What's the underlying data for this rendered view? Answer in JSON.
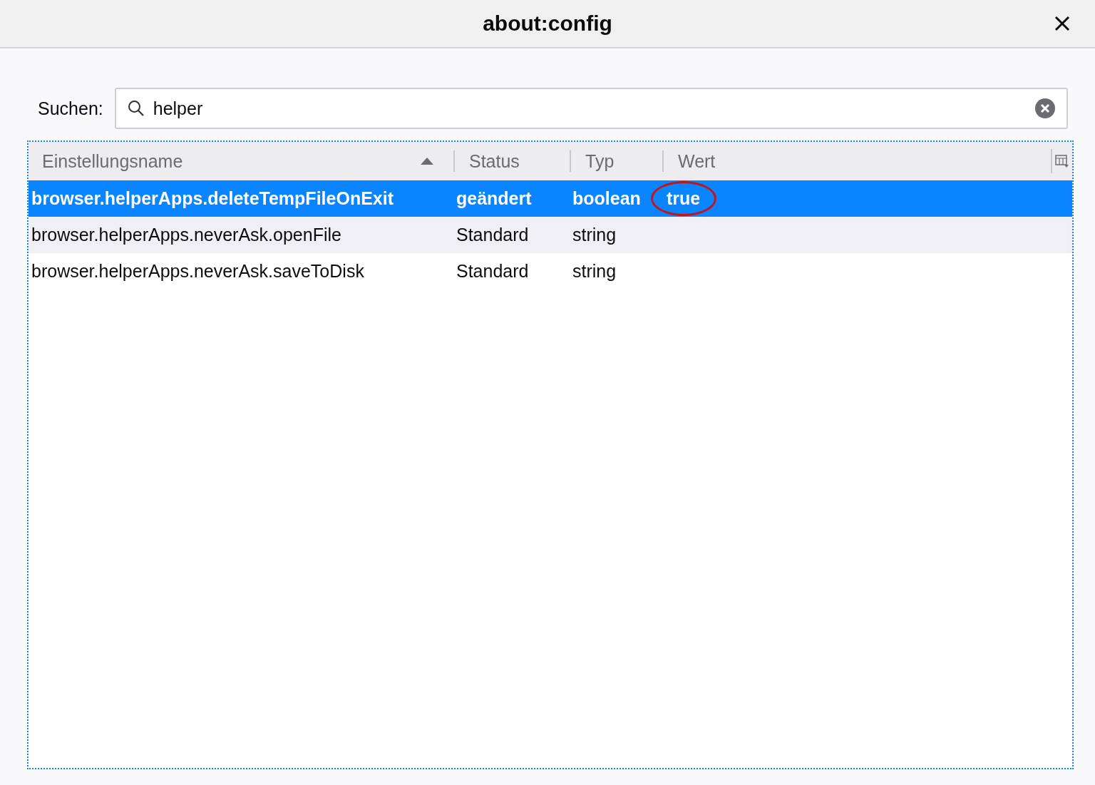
{
  "window": {
    "title": "about:config"
  },
  "search": {
    "label": "Suchen:",
    "value": "helper"
  },
  "table": {
    "columns": [
      {
        "label": "Einstellungsname",
        "sorted": true
      },
      {
        "label": "Status",
        "sorted": false
      },
      {
        "label": "Typ",
        "sorted": false
      },
      {
        "label": "Wert",
        "sorted": false
      }
    ],
    "rows": [
      {
        "name": "browser.helperApps.deleteTempFileOnExit",
        "status": "geändert",
        "type": "boolean",
        "value": "true",
        "selected": true,
        "circled": true
      },
      {
        "name": "browser.helperApps.neverAsk.openFile",
        "status": "Standard",
        "type": "string",
        "selected": false,
        "circled": false
      },
      {
        "name": "browser.helperApps.neverAsk.saveToDisk",
        "status": "Standard",
        "type": "string",
        "selected": false,
        "circled": false
      }
    ]
  }
}
